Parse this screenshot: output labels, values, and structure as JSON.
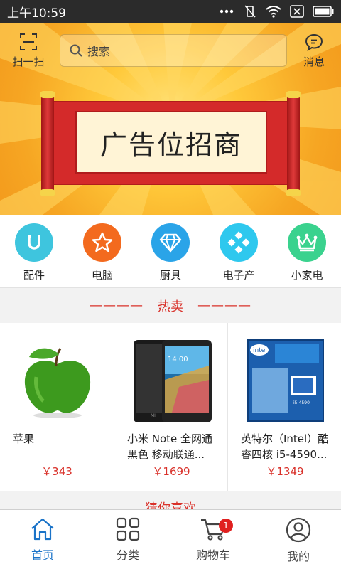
{
  "status_bar": {
    "time": "上午10:59"
  },
  "top_bar": {
    "scan_label": "扫一扫",
    "search_placeholder": "搜索",
    "messages_label": "消息"
  },
  "banner": {
    "text": "广告位招商"
  },
  "categories": [
    {
      "label": "配件",
      "icon": "magnet-icon",
      "color": "#3ec5de"
    },
    {
      "label": "电脑",
      "icon": "star-icon",
      "color": "#f36a1e"
    },
    {
      "label": "厨具",
      "icon": "diamond-icon",
      "color": "#2aa4e8"
    },
    {
      "label": "电子产",
      "icon": "dots-icon",
      "color": "#2ec8ee"
    },
    {
      "label": "小家电",
      "icon": "crown-icon",
      "color": "#3ad28e"
    }
  ],
  "hot_section": {
    "dash_left": "————",
    "title": "热卖",
    "dash_right": "————"
  },
  "products": [
    {
      "name": "苹果",
      "price": "￥343",
      "image": "green-apple"
    },
    {
      "name": "小米 Note 全网通 黑色 移动联通...",
      "price": "￥1699",
      "image": "smartphone"
    },
    {
      "name": "英特尔（Intel）酷睿四核 i5-4590...",
      "price": "￥1349",
      "image": "cpu-box"
    }
  ],
  "guess_section": {
    "title": "猜你喜欢"
  },
  "tab_bar": {
    "tabs": [
      {
        "label": "首页",
        "icon": "home-icon",
        "active": true
      },
      {
        "label": "分类",
        "icon": "grid-icon",
        "active": false
      },
      {
        "label": "购物车",
        "icon": "cart-icon",
        "active": false,
        "badge": "1"
      },
      {
        "label": "我的",
        "icon": "user-icon",
        "active": false
      }
    ]
  },
  "colors": {
    "accent": "#1a73c8",
    "price": "#d9312a",
    "banner": "#f6a623"
  }
}
